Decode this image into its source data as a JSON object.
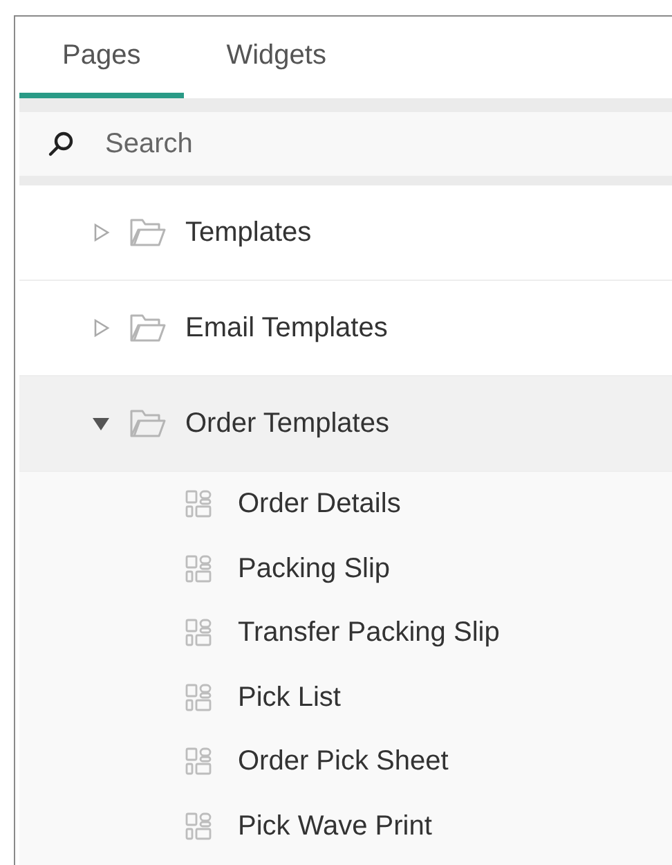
{
  "tabs": [
    {
      "label": "Pages",
      "selected": true
    },
    {
      "label": "Widgets",
      "selected": false
    }
  ],
  "search": {
    "placeholder": "Search"
  },
  "tree": [
    {
      "label": "Templates",
      "expanded": false,
      "selected": false
    },
    {
      "label": "Email Templates",
      "expanded": false,
      "selected": false
    },
    {
      "label": "Order Templates",
      "expanded": true,
      "selected": true,
      "children": [
        {
          "label": "Order Details"
        },
        {
          "label": "Packing Slip"
        },
        {
          "label": "Transfer Packing Slip"
        },
        {
          "label": "Pick List"
        },
        {
          "label": "Order Pick Sheet"
        },
        {
          "label": "Pick Wave Print"
        }
      ]
    }
  ]
}
